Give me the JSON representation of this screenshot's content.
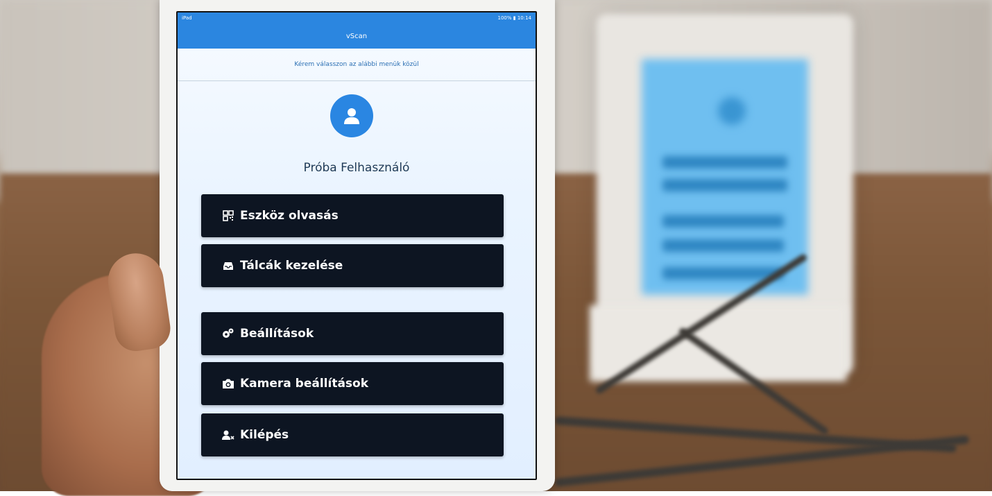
{
  "status_bar": {
    "left": "iPad",
    "right": "100% ▮ 10:14"
  },
  "app_title": "vScan",
  "subtitle": "Kérem válasszon az alábbi menük közül",
  "user": {
    "name": "Próba Felhasználó"
  },
  "menu": [
    {
      "label": "Eszköz olvasás",
      "icon": "qr-code-icon"
    },
    {
      "label": "Tálcák kezelése",
      "icon": "tray-icon"
    },
    {
      "label": "Beállítások",
      "icon": "gears-icon"
    },
    {
      "label": "Kamera beállítások",
      "icon": "camera-icon"
    },
    {
      "label": "Kilépés",
      "icon": "user-remove-icon"
    }
  ],
  "colors": {
    "primary": "#2b86e0",
    "button": "#0d1522",
    "button_text": "#ffffff"
  }
}
